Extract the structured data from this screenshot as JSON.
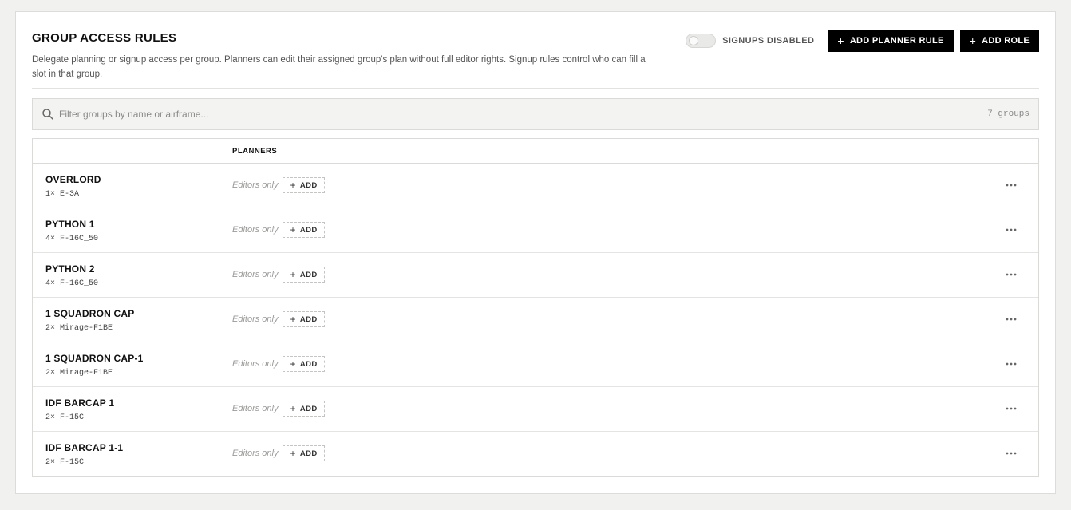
{
  "header": {
    "title": "GROUP ACCESS RULES",
    "description": "Delegate planning or signup access per group. Planners can edit their assigned group's plan without full editor rights. Signup rules control who can fill a slot in that group.",
    "signups_toggle_label": "SIGNUPS DISABLED",
    "signups_enabled": false,
    "add_planner_rule_label": "ADD PLANNER RULE",
    "add_role_label": "ADD ROLE"
  },
  "search": {
    "placeholder": "Filter groups by name or airframe...",
    "value": "",
    "count_label": "7 groups"
  },
  "table": {
    "col_planners": "PLANNERS",
    "rows": [
      {
        "name": "OVERLORD",
        "airframe": "1× E-3A",
        "planners": "Editors only",
        "add_label": "ADD"
      },
      {
        "name": "PYTHON 1",
        "airframe": "4× F-16C_50",
        "planners": "Editors only",
        "add_label": "ADD"
      },
      {
        "name": "PYTHON 2",
        "airframe": "4× F-16C_50",
        "planners": "Editors only",
        "add_label": "ADD"
      },
      {
        "name": "1 SQUADRON CAP",
        "airframe": "2× Mirage-F1BE",
        "planners": "Editors only",
        "add_label": "ADD"
      },
      {
        "name": "1 SQUADRON CAP-1",
        "airframe": "2× Mirage-F1BE",
        "planners": "Editors only",
        "add_label": "ADD"
      },
      {
        "name": "IDF BARCAP 1",
        "airframe": "2× F-15C",
        "planners": "Editors only",
        "add_label": "ADD"
      },
      {
        "name": "IDF BARCAP 1-1",
        "airframe": "2× F-15C",
        "planners": "Editors only",
        "add_label": "ADD"
      }
    ]
  },
  "icons": {
    "search": "search-icon",
    "plus": "plus-icon",
    "more": "more-horizontal-icon"
  },
  "colors": {
    "page_bg": "#f1f1ef",
    "button_bg": "#000000",
    "button_text": "#ffffff"
  }
}
